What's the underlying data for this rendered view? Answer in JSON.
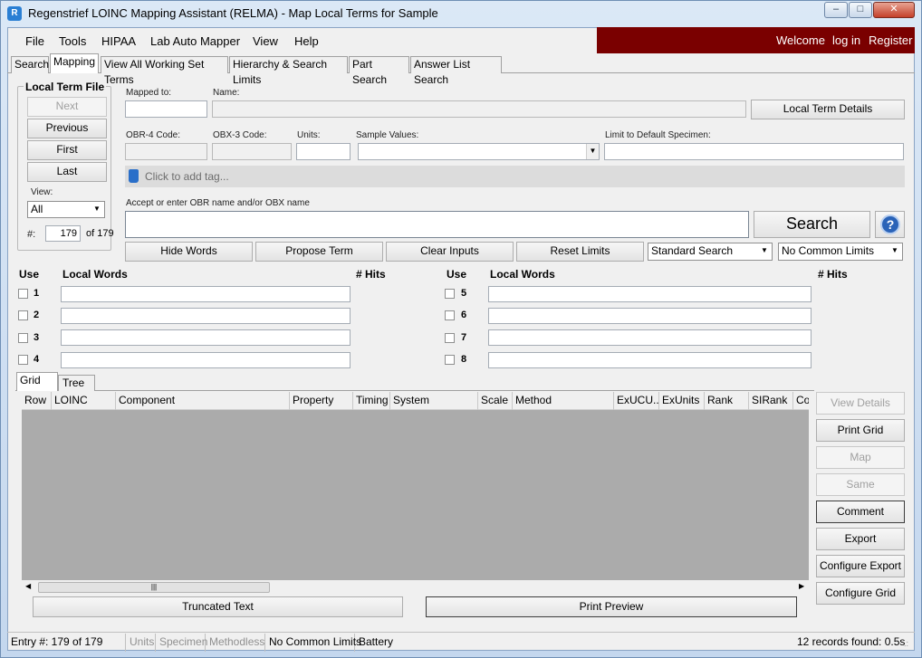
{
  "window": {
    "title": "Regenstrief LOINC Mapping Assistant (RELMA) - Map Local Terms  for Sample",
    "icon": "relma-app-icon",
    "minimize": "–",
    "maximize": "□",
    "close": "✕"
  },
  "menu": [
    "File",
    "Tools",
    "HIPAA",
    "Lab Auto Mapper",
    "View",
    "Help"
  ],
  "user_bar": {
    "welcome": "Welcome",
    "login": "log in",
    "register": "Register",
    "color": "#7a0000"
  },
  "tabs": [
    "Search",
    "Mapping",
    "View All Working Set Terms",
    "Hierarchy & Search Limits",
    "Part Search",
    "Answer List Search"
  ],
  "local_term_file": {
    "title": "Local Term File",
    "buttons": [
      "Next",
      "Previous",
      "First",
      "Last"
    ],
    "view_label": "View:",
    "view_value": "All",
    "num_label": "#:",
    "num_value": "179",
    "of_text": "of 179"
  },
  "fields": {
    "mapped_to": "Mapped to:",
    "name": "Name:",
    "local_term_details": "Local Term Details",
    "obr4": "OBR-4 Code:",
    "obx3": "OBX-3 Code:",
    "units": "Units:",
    "sample_values": "Sample Values:",
    "limit_specimen": "Limit to Default Specimen:",
    "tag_placeholder": "Click to add tag...",
    "accept_label": "Accept or enter OBR name and/or OBX name",
    "search": "Search",
    "help": "?"
  },
  "actions": {
    "hide_words": "Hide Words",
    "propose_term": "Propose Term",
    "clear_inputs": "Clear Inputs",
    "reset_limits": "Reset Limits",
    "search_type": "Standard Search",
    "common_limits": "No Common Limits"
  },
  "words": {
    "use": "Use",
    "local_words": "Local Words",
    "hits": "# Hits",
    "rows_left": [
      "1",
      "2",
      "3",
      "4"
    ],
    "rows_right": [
      "5",
      "6",
      "7",
      "8"
    ]
  },
  "result_tabs": [
    "Grid",
    "Tree"
  ],
  "grid_columns": [
    "Row",
    "LOINC",
    "Component",
    "Property",
    "Timing",
    "System",
    "Scale",
    "Method",
    "ExUCU...",
    "ExUnits",
    "Rank",
    "SIRank",
    "Co"
  ],
  "side_buttons": [
    {
      "label": "View Details",
      "disabled": true
    },
    {
      "label": "Print Grid",
      "disabled": false
    },
    {
      "label": "Map",
      "disabled": true
    },
    {
      "label": "Same",
      "disabled": true
    },
    {
      "label": "Comment",
      "disabled": false
    },
    {
      "label": "Export",
      "disabled": false
    },
    {
      "label": "Configure Export",
      "disabled": false
    },
    {
      "label": "Configure Grid",
      "disabled": false
    }
  ],
  "bottom": {
    "truncated_text": "Truncated Text",
    "print_preview": "Print Preview"
  },
  "status": {
    "entry": "Entry #: 179 of 179",
    "units": "Units",
    "specimen": "Specimen",
    "methodless": "Methodless",
    "common_limits": "No Common Limits",
    "battery": "Battery",
    "records": "12 records found: 0.5s"
  }
}
